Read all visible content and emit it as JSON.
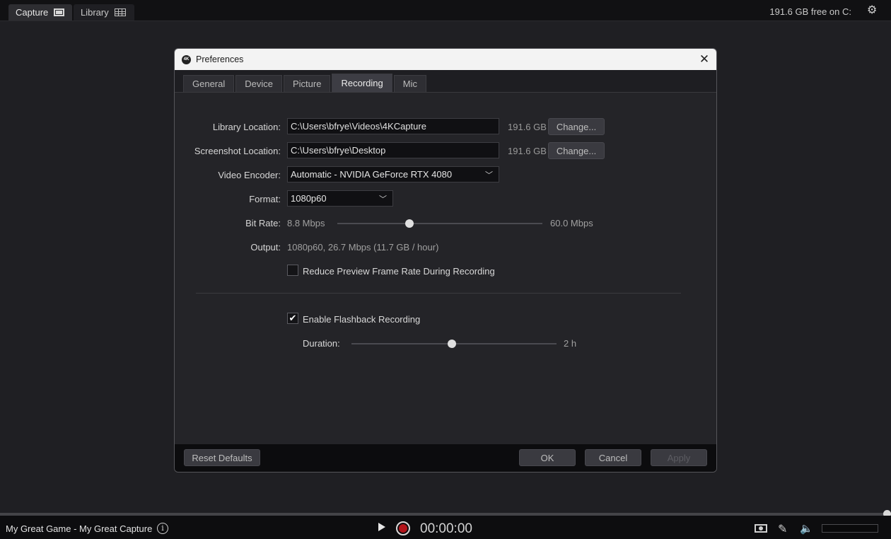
{
  "topbar": {
    "tabs": [
      {
        "label": "Capture",
        "icon": "monitor-icon",
        "active": true
      },
      {
        "label": "Library",
        "icon": "grid-list-icon",
        "active": false
      }
    ],
    "free_space": "191.6 GB free on C:",
    "settings_icon": "gear-icon"
  },
  "dialog": {
    "title": "Preferences",
    "logo_text": "4K",
    "tabs": [
      {
        "label": "General",
        "active": false
      },
      {
        "label": "Device",
        "active": false
      },
      {
        "label": "Picture",
        "active": false
      },
      {
        "label": "Recording",
        "active": true
      },
      {
        "label": "Mic",
        "active": false
      }
    ],
    "library_location": {
      "label": "Library Location:",
      "value": "C:\\Users\\bfrye\\Videos\\4KCapture",
      "size": "191.6 GB",
      "button": "Change..."
    },
    "screenshot_location": {
      "label": "Screenshot Location:",
      "value": "C:\\Users\\bfrye\\Desktop",
      "size": "191.6 GB",
      "button": "Change..."
    },
    "video_encoder": {
      "label": "Video Encoder:",
      "value": "Automatic - NVIDIA GeForce RTX 4080"
    },
    "format": {
      "label": "Format:",
      "value": "1080p60"
    },
    "bit_rate": {
      "label": "Bit Rate:",
      "min": "8.8 Mbps",
      "max": "60.0 Mbps",
      "level": 0.35
    },
    "output": {
      "label": "Output:",
      "value": "1080p60, 26.7 Mbps (11.7 GB / hour)"
    },
    "reduce_preview": {
      "label": "Reduce Preview Frame Rate During Recording",
      "checked": false
    },
    "flashback": {
      "label": "Enable Flashback Recording",
      "checked": true,
      "check_glyph": "✔"
    },
    "duration": {
      "label": "Duration:",
      "value": "2 h",
      "level": 0.49
    },
    "footer": {
      "reset": "Reset Defaults",
      "ok": "OK",
      "cancel": "Cancel",
      "apply": "Apply"
    }
  },
  "bottombar": {
    "project": "My Great Game - My Great Capture",
    "timer": "00:00:00",
    "progress": 1.0
  },
  "colors": {
    "background": "#1f1f23",
    "record": "#b3141a"
  }
}
